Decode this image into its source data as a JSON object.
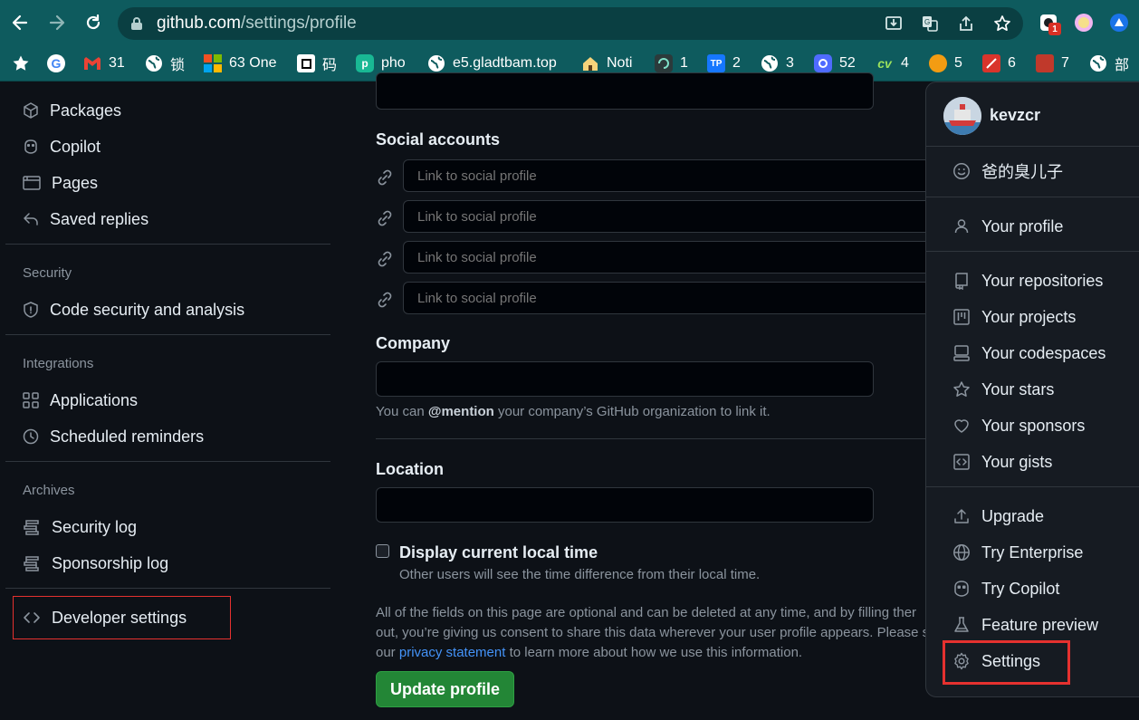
{
  "browser": {
    "url_host": "github.com",
    "url_path": "/settings/profile",
    "extension_badge": "1",
    "bookmarks": [
      {
        "label": "",
        "icon": "star-icon"
      },
      {
        "label": "",
        "icon": "google-icon"
      },
      {
        "label": "31",
        "icon": "gmail-icon"
      },
      {
        "label": "锁",
        "icon": "globe-icon"
      },
      {
        "label": "63 One",
        "icon": "microsoft-icon"
      },
      {
        "label": "码",
        "icon": "square-icon"
      },
      {
        "label": "pho",
        "icon": "app-icon"
      },
      {
        "label": "e5.gladtbam.top",
        "icon": "globe-icon"
      },
      {
        "label": "Noti",
        "icon": "home-icon"
      },
      {
        "label": "1",
        "icon": "app-icon"
      },
      {
        "label": "2",
        "icon": "tp-icon"
      },
      {
        "label": "3",
        "icon": "globe-icon"
      },
      {
        "label": "52",
        "icon": "app-icon"
      },
      {
        "label": "4",
        "icon": "app-icon"
      },
      {
        "label": "5",
        "icon": "app-icon"
      },
      {
        "label": "6",
        "icon": "app-icon"
      },
      {
        "label": "7",
        "icon": "app-icon"
      },
      {
        "label": "部",
        "icon": "globe-icon"
      }
    ]
  },
  "sidebar": {
    "items_top": [
      {
        "label": "Packages",
        "icon": "package-icon"
      },
      {
        "label": "Copilot",
        "icon": "copilot-icon"
      },
      {
        "label": "Pages",
        "icon": "browser-icon"
      },
      {
        "label": "Saved replies",
        "icon": "reply-icon"
      }
    ],
    "security_heading": "Security",
    "security_items": [
      {
        "label": "Code security and analysis",
        "icon": "shield-icon"
      }
    ],
    "integrations_heading": "Integrations",
    "integrations_items": [
      {
        "label": "Applications",
        "icon": "apps-icon"
      },
      {
        "label": "Scheduled reminders",
        "icon": "clock-icon"
      }
    ],
    "archives_heading": "Archives",
    "archives_items": [
      {
        "label": "Security log",
        "icon": "log-icon"
      },
      {
        "label": "Sponsorship log",
        "icon": "log-icon"
      }
    ],
    "developer_settings": "Developer settings"
  },
  "form": {
    "social_heading": "Social accounts",
    "social_placeholder": "Link to social profile",
    "company_label": "Company",
    "company_value": "",
    "company_note_prefix": "You can ",
    "company_note_mention": "@mention",
    "company_note_suffix": " your company’s GitHub organization to link it.",
    "location_label": "Location",
    "location_value": "",
    "local_time_label": "Display current local time",
    "local_time_note": "Other users will see the time difference from their local time.",
    "disclaimer_line1": "All of the fields on this page are optional and can be deleted at any time, and by filling ther",
    "disclaimer_line2": "out, you’re giving us consent to share this data wherever your user profile appears. Please se",
    "disclaimer_line3_prefix": "our ",
    "disclaimer_link": "privacy statement",
    "disclaimer_line3_suffix": " to learn more about how we use this information.",
    "update_button": "Update profile"
  },
  "user_menu": {
    "username": "kevzcr",
    "status": "爸的臭儿子",
    "items": [
      {
        "label": "Your profile",
        "icon": "person-icon"
      },
      {
        "label": "Your repositories",
        "icon": "repo-icon"
      },
      {
        "label": "Your projects",
        "icon": "project-icon"
      },
      {
        "label": "Your codespaces",
        "icon": "codespaces-icon"
      },
      {
        "label": "Your stars",
        "icon": "star-icon"
      },
      {
        "label": "Your sponsors",
        "icon": "heart-icon"
      },
      {
        "label": "Your gists",
        "icon": "code-square-icon"
      },
      {
        "label": "Upgrade",
        "icon": "upload-icon"
      },
      {
        "label": "Try Enterprise",
        "icon": "globe-icon"
      },
      {
        "label": "Try Copilot",
        "icon": "copilot-icon"
      },
      {
        "label": "Feature preview",
        "icon": "beaker-icon"
      },
      {
        "label": "Settings",
        "icon": "gear-icon"
      }
    ]
  },
  "colors": {
    "page_bg": "#0d1117",
    "browser_chrome": "#0e5b5e",
    "highlight_box": "#e5312f",
    "primary_button": "#238636",
    "link": "#4493f8"
  }
}
